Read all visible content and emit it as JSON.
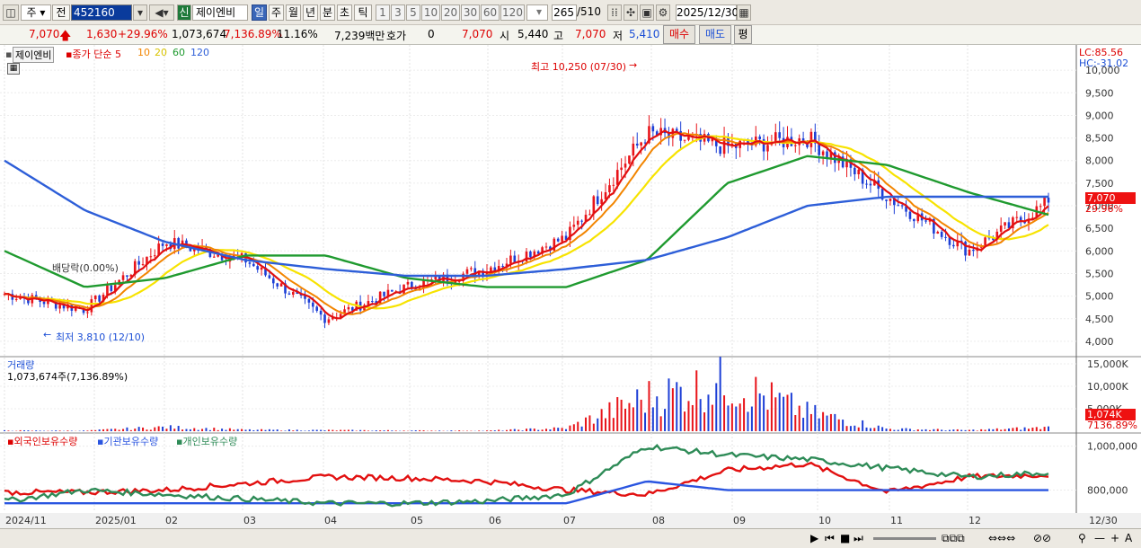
{
  "toolbar": {
    "period": "주",
    "side": "전",
    "code": "452160",
    "name_badge": "신",
    "stock_name": "제이엔비",
    "btn_day": "일",
    "btn_week": "주",
    "btn_month": "월",
    "btn_year": "년",
    "btn_min": "분",
    "btn_sec": "초",
    "btn_tick": "틱",
    "intervals": [
      "1",
      "3",
      "5",
      "10",
      "20",
      "30",
      "60",
      "120"
    ],
    "count": "265",
    "count_total": "/510",
    "date": "2025/12/30"
  },
  "quote": {
    "price": "7,070",
    "change": "1,630",
    "change_pct": "+29.96%",
    "volume": "1,073,674",
    "vol_pct": "7,136.89%",
    "turnover_pct": "11.16%",
    "amount": "7,239백만",
    "ask_label": "호가",
    "ask_value": "0",
    "ask_price": "7,070",
    "open_label": "시",
    "open": "5,440",
    "high_label": "고",
    "high": "7,070",
    "low_label": "저",
    "low": "5,410",
    "buy_label": "매수",
    "sell_label": "매도",
    "avg_label": "평"
  },
  "price_panel": {
    "legend_name": "제이엔비",
    "legend_series": "종가 단순",
    "ma": [
      "5",
      "10",
      "20",
      "60",
      "120"
    ],
    "lc": "LC:85.56",
    "hc": "HC:-31.02",
    "high_note": "최고 10,250 (07/30)",
    "low_note": "최저 3,810 (12/10)",
    "div_note": "배당락(0.00%)",
    "yticks": [
      "10,000",
      "9,500",
      "9,000",
      "8,500",
      "8,000",
      "7,500",
      "7,000",
      "6,500",
      "6,000",
      "5,500",
      "5,000",
      "4,500",
      "4,000"
    ],
    "tag_price": "7,070",
    "tag_pct": "29.96%"
  },
  "volume_panel": {
    "title": "거래량",
    "value": "1,073,674주(7,136.89%)",
    "yticks": [
      "15,000K",
      "10,000K",
      "5,000K"
    ],
    "tag_vol": "1,074K",
    "tag_pct": "7136.89%"
  },
  "holdings_panel": {
    "series": [
      "외국인보유수량",
      "기관보유수량",
      "개인보유수량"
    ],
    "yticks": [
      "1,000,000",
      "800,000"
    ]
  },
  "xaxis": {
    "labels": [
      "2024/11",
      "2025/01",
      "02",
      "03",
      "04",
      "05",
      "06",
      "07",
      "08",
      "09",
      "10",
      "11",
      "12"
    ],
    "end": "12/30"
  },
  "colors": {
    "up": "#e8141a",
    "down": "#1d3fd6",
    "ma5": "#e21010",
    "ma10": "#f28500",
    "ma20": "#f7e300",
    "ma60": "#1f9a2f",
    "ma120": "#2d5ed8",
    "foreign": "#e21010",
    "inst": "#2a55e0",
    "indiv": "#2e8b57"
  },
  "chart_data": [
    {
      "type": "line",
      "title": "종가 단순",
      "x": [
        "2024/11",
        "2025/01",
        "02",
        "03",
        "04",
        "05",
        "06",
        "07",
        "08",
        "09",
        "10",
        "11",
        "12",
        "12/30"
      ],
      "series": [
        {
          "name": "종가",
          "values": [
            5050,
            4700,
            6200,
            5800,
            4500,
            5200,
            5600,
            6300,
            8600,
            8300,
            8500,
            7200,
            6000,
            7070
          ]
        },
        {
          "name": "120",
          "values": [
            8000,
            6900,
            6200,
            5800,
            5600,
            5450,
            5450,
            5600,
            5800,
            6300,
            7000,
            7200,
            7200,
            7200
          ]
        },
        {
          "name": "60",
          "values": [
            6000,
            5200,
            5400,
            5900,
            5900,
            5400,
            5200,
            5200,
            5800,
            7500,
            8100,
            7900,
            7300,
            6800
          ]
        }
      ],
      "ylim": [
        3700,
        10500
      ]
    },
    {
      "type": "bar",
      "title": "거래량",
      "values_k": [
        200,
        150,
        1200,
        400,
        300,
        200,
        150,
        900,
        10000,
        14500,
        5500,
        700,
        300,
        1074
      ],
      "ylim": [
        0,
        16000
      ]
    },
    {
      "type": "line",
      "title": "보유수량",
      "series": [
        {
          "name": "외국인보유수량",
          "values": [
            790,
            790,
            800,
            830,
            860,
            855,
            840,
            800,
            780,
            890,
            920,
            790,
            860,
            870
          ]
        },
        {
          "name": "기관보유수량",
          "values": [
            740,
            740,
            740,
            740,
            740,
            740,
            740,
            740,
            840,
            800,
            800,
            800,
            800,
            800
          ]
        },
        {
          "name": "개인보유수량",
          "values": [
            750,
            800,
            780,
            760,
            740,
            740,
            750,
            780,
            1000,
            960,
            940,
            900,
            860,
            880
          ]
        }
      ],
      "ylim": [
        700,
        1060
      ]
    }
  ]
}
